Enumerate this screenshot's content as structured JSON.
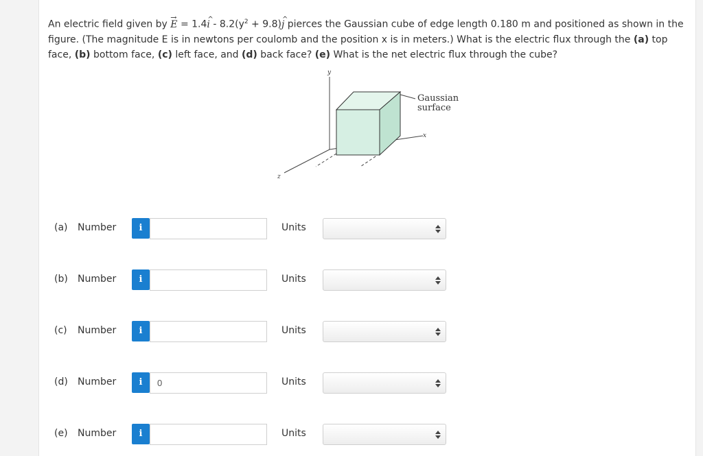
{
  "question": {
    "intro": "An electric field given by ",
    "vector_symbol": "E",
    "equation_a": " = 1.4",
    "i_hat": "i",
    "equation_b": " - 8.2(y",
    "exponent": "2",
    "equation_c": " + 9.8)",
    "j_hat": "j",
    "rest_1": " pierces the Gaussian cube of edge length 0.180 m and positioned as shown in the figure. (The magnitude E is in newtons per coulomb and the position x is in meters.) What is the electric flux through the ",
    "a_tag": "(a)",
    "a_text": " top face, ",
    "b_tag": "(b)",
    "b_text": " bottom face, ",
    "c_tag": "(c)",
    "c_text": " left face, and ",
    "d_tag": "(d)",
    "d_text": " back face? ",
    "e_tag": "(e)",
    "e_text": " What is the net electric flux through the cube?"
  },
  "figure": {
    "y_axis": "y",
    "z_axis": "z",
    "x_axis": "x",
    "gaussian_line1": "Gaussian",
    "gaussian_line2": "surface"
  },
  "rows": [
    {
      "letter": "(a)",
      "number_label": "Number",
      "info_icon": "i",
      "value": "",
      "units_label": "Units",
      "units_value": ""
    },
    {
      "letter": "(b)",
      "number_label": "Number",
      "info_icon": "i",
      "value": "",
      "units_label": "Units",
      "units_value": ""
    },
    {
      "letter": "(c)",
      "number_label": "Number",
      "info_icon": "i",
      "value": "",
      "units_label": "Units",
      "units_value": ""
    },
    {
      "letter": "(d)",
      "number_label": "Number",
      "info_icon": "i",
      "value": "0",
      "units_label": "Units",
      "units_value": ""
    },
    {
      "letter": "(e)",
      "number_label": "Number",
      "info_icon": "i",
      "value": "",
      "units_label": "Units",
      "units_value": ""
    }
  ],
  "colors": {
    "info_button": "#1a7fd0",
    "cube_fill": "#d6efe3"
  }
}
